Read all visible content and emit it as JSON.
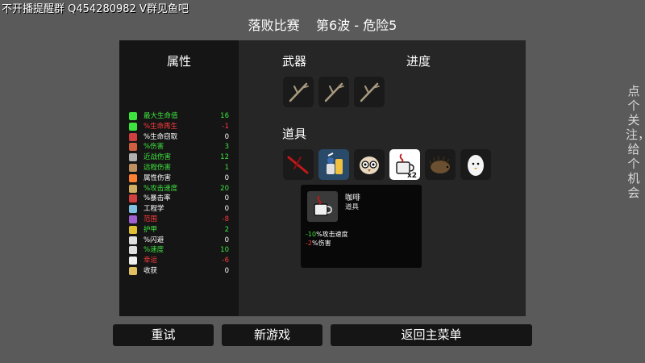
{
  "overlay": {
    "stream_banner": "不开播提醒群  Q454280982 V群见鱼吧",
    "right_text": "点个关注，给个机会"
  },
  "header": {
    "title": "落败比赛    第6波 - 危险5"
  },
  "stats": {
    "title": "属性",
    "rows": [
      {
        "name": "最大生命值",
        "value": "16",
        "color": "green",
        "icon": "heart-icon"
      },
      {
        "name": "%生命再生",
        "value": "-1",
        "color": "red",
        "icon": "heart-regen-icon"
      },
      {
        "name": "%生命窃取",
        "value": "0",
        "color": "white",
        "icon": "lifesteal-icon"
      },
      {
        "name": "%伤害",
        "value": "3",
        "color": "green",
        "icon": "fist-icon"
      },
      {
        "name": "近战伤害",
        "value": "12",
        "color": "green",
        "icon": "sword-icon"
      },
      {
        "name": "远程伤害",
        "value": "1",
        "color": "green",
        "icon": "bow-icon"
      },
      {
        "name": "属性伤害",
        "value": "0",
        "color": "white",
        "icon": "flame-icon"
      },
      {
        "name": "%攻击速度",
        "value": "20",
        "color": "green",
        "icon": "hourglass-icon"
      },
      {
        "name": "%暴击率",
        "value": "0",
        "color": "white",
        "icon": "crit-icon"
      },
      {
        "name": "工程学",
        "value": "0",
        "color": "white",
        "icon": "wrench-icon"
      },
      {
        "name": "范围",
        "value": "-8",
        "color": "red",
        "icon": "range-icon"
      },
      {
        "name": "护甲",
        "value": "2",
        "color": "green",
        "icon": "shield-icon"
      },
      {
        "name": "%闪避",
        "value": "0",
        "color": "white",
        "icon": "dodge-icon"
      },
      {
        "name": "%速度",
        "value": "10",
        "color": "green",
        "icon": "boot-icon"
      },
      {
        "name": "幸运",
        "value": "-6",
        "color": "red",
        "icon": "dice-icon"
      },
      {
        "name": "收获",
        "value": "0",
        "color": "white",
        "icon": "harvest-icon"
      }
    ]
  },
  "weapons": {
    "title": "武器",
    "items": [
      "stick-weapon-icon",
      "stick-weapon-icon",
      "stick-weapon-icon"
    ]
  },
  "progress": {
    "title": "进度"
  },
  "items": {
    "title": "道具",
    "list": [
      {
        "icon": "red-weapon-item-icon"
      },
      {
        "icon": "potion-item-icon"
      },
      {
        "icon": "owl-item-icon"
      },
      {
        "icon": "coffee-item-icon",
        "count": "x2",
        "selected": true
      },
      {
        "icon": "hedgehog-item-icon"
      },
      {
        "icon": "egg-item-icon"
      }
    ]
  },
  "tooltip": {
    "name": "咖啡",
    "type": "道具",
    "effects": [
      {
        "value": "-10",
        "text": "%攻击速度"
      },
      {
        "value": "-2",
        "text": "%伤害"
      }
    ]
  },
  "buttons": {
    "retry": "重试",
    "new_game": "新游戏",
    "main_menu": "返回主菜单"
  },
  "colors": {
    "positive": "#3ee43e",
    "negative": "#ff3a3a",
    "background": "#5a5a5a",
    "panel": "#262626"
  }
}
